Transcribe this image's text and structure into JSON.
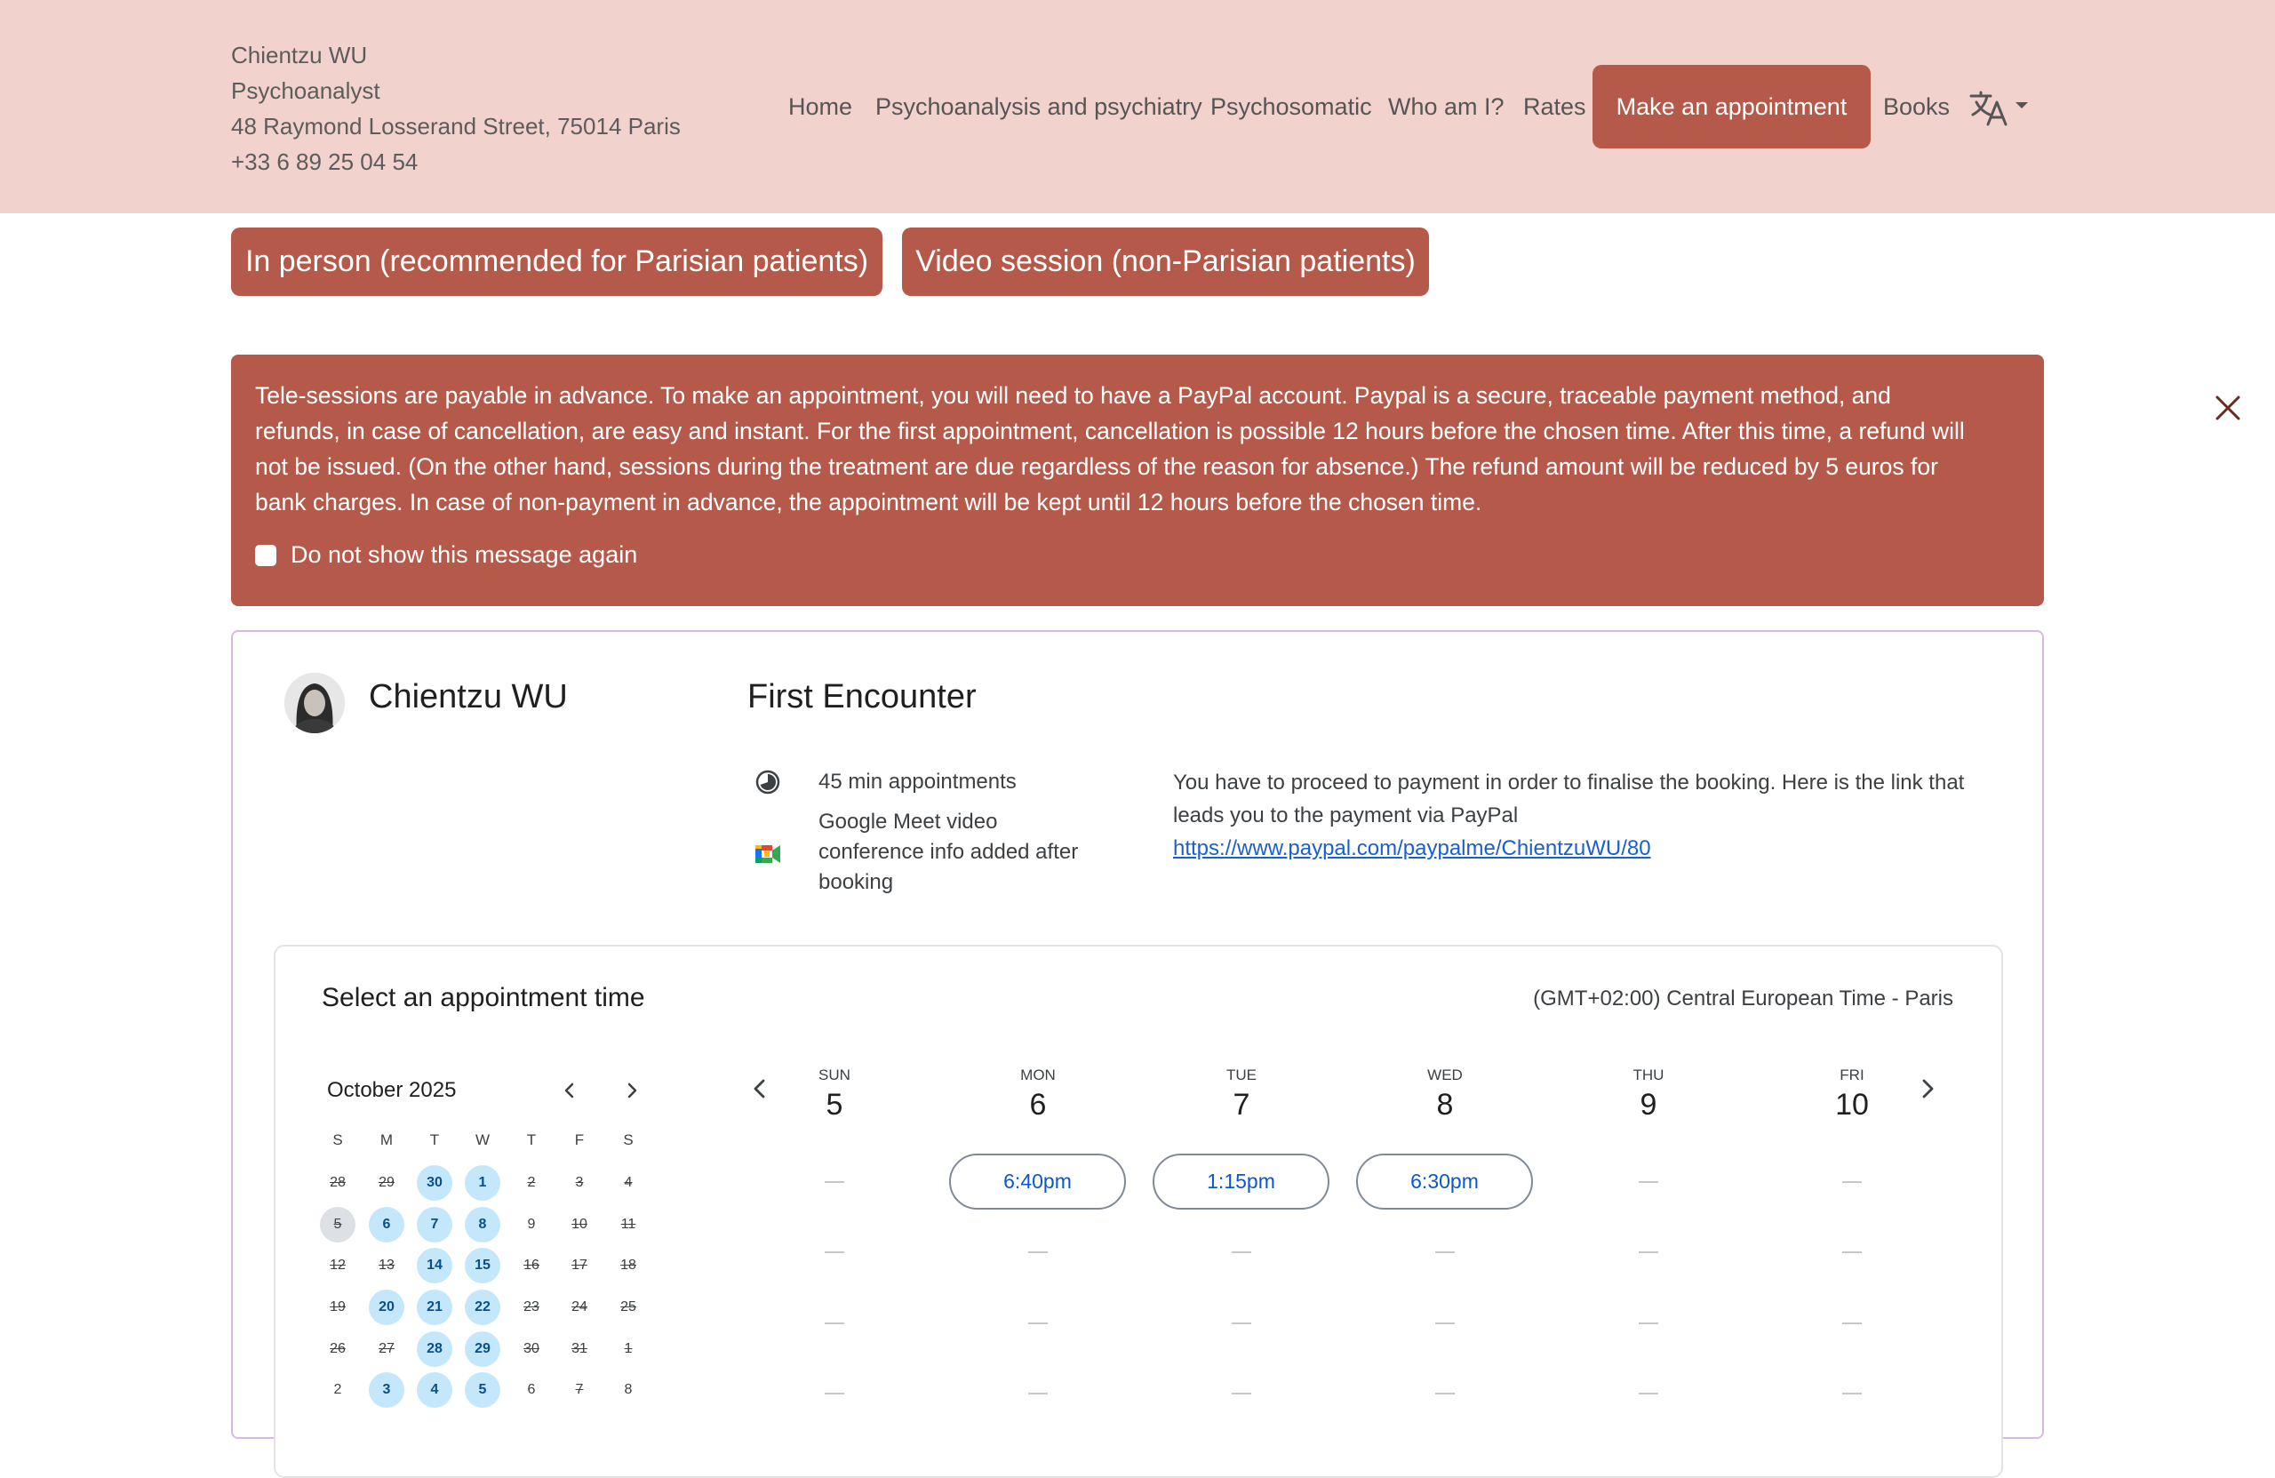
{
  "header": {
    "contact": [
      "Chientzu WU",
      "Psychoanalyst",
      "48 Raymond Losserand Street, 75014 Paris",
      "+33 6 89 25 04 54"
    ],
    "nav": [
      {
        "label": "Home"
      },
      {
        "label": "Psychoanalysis and psychiatry"
      },
      {
        "label": "Psychosomatic"
      },
      {
        "label": "Who am I?"
      },
      {
        "label": "Rates"
      },
      {
        "label": "Make an appointment",
        "active": true
      },
      {
        "label": "Books"
      }
    ],
    "language_icon": "translate-icon"
  },
  "mode_buttons": {
    "in_person": "In person (recommended for Parisian patients)",
    "video": "Video session (non-Parisian patients)"
  },
  "alert": {
    "text": "Tele-sessions are payable in advance. To make an appointment, you will need to have a PayPal account. Paypal is a secure, traceable payment method, and refunds, in case of cancellation, are easy and instant. For the first appointment, cancellation is possible 12 hours before the chosen time. After this time, a refund will not be issued. (On the other hand, sessions during the treatment are due regardless of the reason for absence.) The refund amount will be reduced by 5 euros for bank charges. In case of non-payment in advance, the appointment will be kept until 12 hours before the chosen time.",
    "checkbox_label": "Do not show this message again",
    "checked": false
  },
  "booking": {
    "host_name": "Chientzu WU",
    "event_title": "First Encounter",
    "duration": "45 min appointments",
    "meet_info": [
      "Google Meet video",
      "conference info added after",
      "booking"
    ],
    "description": [
      "You have to proceed to payment in order to finalise the booking. Here is the link that",
      "leads you to the payment via PayPal"
    ],
    "payment_link": "https://www.paypal.com/paypalme/ChientzuWU/80"
  },
  "scheduler": {
    "title": "Select an appointment time",
    "timezone": "(GMT+02:00) Central European Time - Paris",
    "month": "October 2025",
    "weekday_letters": [
      "S",
      "M",
      "T",
      "W",
      "T",
      "F",
      "S"
    ],
    "calendar_rows": [
      [
        {
          "d": "28",
          "s": "past"
        },
        {
          "d": "29",
          "s": "past"
        },
        {
          "d": "30",
          "s": "avail"
        },
        {
          "d": "1",
          "s": "avail"
        },
        {
          "d": "2",
          "s": "past"
        },
        {
          "d": "3",
          "s": "past"
        },
        {
          "d": "4",
          "s": "past"
        }
      ],
      [
        {
          "d": "5",
          "s": "today"
        },
        {
          "d": "6",
          "s": "avail"
        },
        {
          "d": "7",
          "s": "avail"
        },
        {
          "d": "8",
          "s": "avail"
        },
        {
          "d": "9",
          "s": "plain"
        },
        {
          "d": "10",
          "s": "past"
        },
        {
          "d": "11",
          "s": "past"
        }
      ],
      [
        {
          "d": "12",
          "s": "past"
        },
        {
          "d": "13",
          "s": "past"
        },
        {
          "d": "14",
          "s": "avail"
        },
        {
          "d": "15",
          "s": "avail"
        },
        {
          "d": "16",
          "s": "past"
        },
        {
          "d": "17",
          "s": "past"
        },
        {
          "d": "18",
          "s": "past"
        }
      ],
      [
        {
          "d": "19",
          "s": "past"
        },
        {
          "d": "20",
          "s": "avail"
        },
        {
          "d": "21",
          "s": "avail"
        },
        {
          "d": "22",
          "s": "avail"
        },
        {
          "d": "23",
          "s": "past"
        },
        {
          "d": "24",
          "s": "past"
        },
        {
          "d": "25",
          "s": "past"
        }
      ],
      [
        {
          "d": "26",
          "s": "past"
        },
        {
          "d": "27",
          "s": "past"
        },
        {
          "d": "28",
          "s": "avail"
        },
        {
          "d": "29",
          "s": "avail"
        },
        {
          "d": "30",
          "s": "past"
        },
        {
          "d": "31",
          "s": "past"
        },
        {
          "d": "1",
          "s": "past"
        }
      ],
      [
        {
          "d": "2",
          "s": "plain"
        },
        {
          "d": "3",
          "s": "avail"
        },
        {
          "d": "4",
          "s": "avail"
        },
        {
          "d": "5",
          "s": "avail"
        },
        {
          "d": "6",
          "s": "plain"
        },
        {
          "d": "7",
          "s": "past"
        },
        {
          "d": "8",
          "s": "plain"
        }
      ]
    ],
    "days": [
      {
        "name": "SUN",
        "date": "5",
        "slots": []
      },
      {
        "name": "MON",
        "date": "6",
        "slots": [
          "6:40pm"
        ]
      },
      {
        "name": "TUE",
        "date": "7",
        "slots": [
          "1:15pm"
        ]
      },
      {
        "name": "WED",
        "date": "8",
        "slots": [
          "6:30pm"
        ]
      },
      {
        "name": "THU",
        "date": "9",
        "slots": []
      },
      {
        "name": "FRI",
        "date": "10",
        "slots": []
      }
    ]
  },
  "colors": {
    "header_bg": "#f2d2cc",
    "accent": "#b55a4a",
    "available_day": "#c4e7fb",
    "link": "#1a5fd1",
    "slot_text": "#0b57d0"
  }
}
